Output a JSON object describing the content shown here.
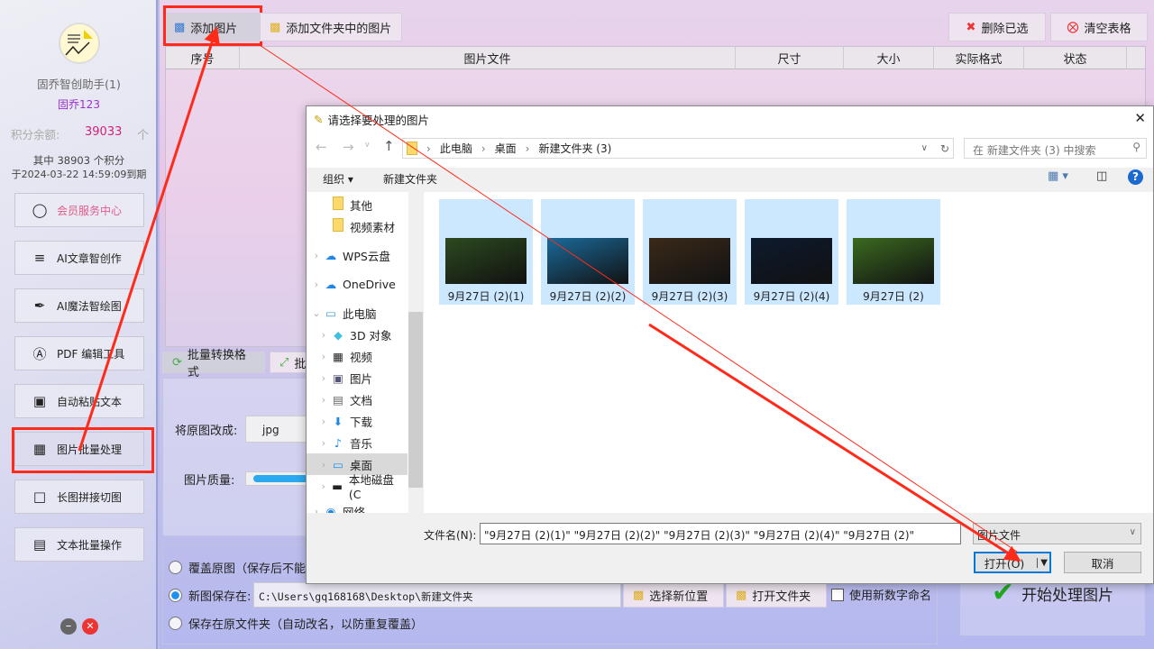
{
  "sidebar": {
    "app_name": "固乔智创助手(1)",
    "user": "固乔123",
    "points_label": "积分余额:",
    "points_value": "39033",
    "points_unit": "个",
    "points_detail": "其中 38903 个积分",
    "expire": "于2024-03-22 14:59:09到期",
    "member_center": "会员服务中心",
    "items": [
      {
        "label": "AI文章智创作",
        "icon": "list-icon"
      },
      {
        "label": "AI魔法智绘图",
        "icon": "brush-icon"
      },
      {
        "label": "PDF 编辑工具",
        "icon": "pdf-icon"
      },
      {
        "label": "自动粘贴文本",
        "icon": "paste-icon"
      },
      {
        "label": "图片批量处理",
        "icon": "image-icon"
      },
      {
        "label": "长图拼接切图",
        "icon": "crop-icon"
      },
      {
        "label": "文本批量操作",
        "icon": "text-icon"
      }
    ]
  },
  "toolbar": {
    "add_image": "添加图片",
    "add_folder": "添加文件夹中的图片",
    "delete_selected": "删除已选",
    "clear_table": "清空表格"
  },
  "table": {
    "columns": [
      "序号",
      "图片文件",
      "尺寸",
      "大小",
      "实际格式",
      "状态"
    ]
  },
  "tabs": [
    "批量转换格式",
    "批"
  ],
  "settings": {
    "convert_label": "将原图改成:",
    "format": "jpg",
    "quality_label": "图片质量:",
    "quality_percent": 100
  },
  "save": {
    "overwrite": "覆盖原图（保存后不能恢",
    "new_save": "新图保存在:",
    "path": "C:\\Users\\gq168168\\Desktop\\新建文件夹",
    "choose": "选择新位置",
    "open_folder": "打开文件夹",
    "numeric_name": "使用新数字命名",
    "keep": "保存在原文件夹（自动改名，以防重复覆盖）",
    "start": "开始处理图片",
    "selected_option": "new_save"
  },
  "dialog": {
    "title": "请选择要处理的图片",
    "breadcrumb": [
      "此电脑",
      "桌面",
      "新建文件夹 (3)"
    ],
    "search_placeholder": "在 新建文件夹 (3) 中搜索",
    "organize": "组织 ▾",
    "new_folder": "新建文件夹",
    "nav": [
      {
        "label": "其他",
        "icon": "folder-icon"
      },
      {
        "label": "视频素材",
        "icon": "folder-icon"
      },
      {
        "label": "WPS云盘",
        "icon": "cloud-icon"
      },
      {
        "label": "OneDrive",
        "icon": "cloud-icon"
      },
      {
        "label": "此电脑",
        "icon": "computer-icon"
      },
      {
        "label": "3D 对象",
        "icon": "cube-icon"
      },
      {
        "label": "视频",
        "icon": "video-icon"
      },
      {
        "label": "图片",
        "icon": "picture-icon"
      },
      {
        "label": "文档",
        "icon": "document-icon"
      },
      {
        "label": "下载",
        "icon": "download-icon"
      },
      {
        "label": "音乐",
        "icon": "music-icon"
      },
      {
        "label": "桌面",
        "icon": "desktop-icon"
      },
      {
        "label": "本地磁盘 (C",
        "icon": "disk-icon"
      },
      {
        "label": "网络",
        "icon": "network-icon"
      }
    ],
    "files": [
      {
        "name": "9月27日 (2)(1)",
        "color": "#2c4a1f"
      },
      {
        "name": "9月27日 (2)(2)",
        "color": "#1a6a9a"
      },
      {
        "name": "9月27日 (2)(3)",
        "color": "#3a2a1a"
      },
      {
        "name": "9月27日 (2)(4)",
        "color": "#0d1a2e"
      },
      {
        "name": "9月27日 (2)",
        "color": "#3b6a20"
      }
    ],
    "filename_label": "文件名(N):",
    "filename_value": "\"9月27日 (2)(1)\" \"9月27日 (2)(2)\" \"9月27日 (2)(3)\" \"9月27日 (2)(4)\" \"9月27日 (2)\"",
    "filetype": "图片文件",
    "open": "打开(O)",
    "cancel": "取消"
  },
  "colors": {
    "accent_red": "#ff2a1a",
    "points": "#d0207a",
    "user": "#9b30d0",
    "member": "#e05c8a"
  }
}
